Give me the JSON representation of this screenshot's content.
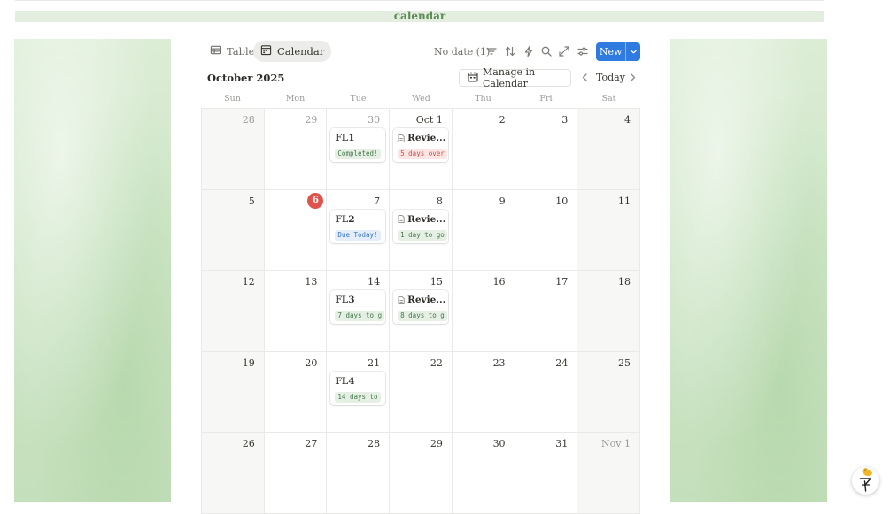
{
  "page": {
    "banner_title": "calendar",
    "colors": {
      "accent": "#2f7be0",
      "today": "#e0534c",
      "banner_bg": "#e3ede0",
      "banner_text": "#5b8a57"
    }
  },
  "views": [
    {
      "label": "Table",
      "icon": "table-icon",
      "active": false
    },
    {
      "label": "Calendar",
      "icon": "calendar-icon",
      "active": true
    }
  ],
  "toolbar": {
    "no_date": "No date (1)",
    "icons": [
      "filter-icon",
      "sort-icon",
      "automation-icon",
      "search-icon",
      "expand-icon",
      "settings-icon"
    ],
    "new_label": "New"
  },
  "calendar": {
    "month_label": "October 2025",
    "manage_label": "Manage in Calendar",
    "today_label": "Today",
    "weekdays": [
      "Sun",
      "Mon",
      "Tue",
      "Wed",
      "Thu",
      "Fri",
      "Sat"
    ],
    "weeks": [
      [
        {
          "label": "28",
          "muted": true
        },
        {
          "label": "29",
          "muted": true
        },
        {
          "label": "30",
          "muted": true,
          "event": {
            "title": "FL1",
            "badge": "Completed!",
            "badge_color": "green",
            "doc_icon": false
          }
        },
        {
          "label": "Oct 1",
          "event": {
            "title": "Revie...",
            "badge": "5 days over",
            "badge_color": "red",
            "doc_icon": true
          }
        },
        {
          "label": "2"
        },
        {
          "label": "3"
        },
        {
          "label": "4"
        }
      ],
      [
        {
          "label": "5"
        },
        {
          "label": "6",
          "today": true
        },
        {
          "label": "7",
          "event": {
            "title": "FL2",
            "badge": "Due Today!",
            "badge_color": "blue",
            "doc_icon": false
          }
        },
        {
          "label": "8",
          "event": {
            "title": "Revie...",
            "badge": "1 day to go",
            "badge_color": "green",
            "doc_icon": true
          }
        },
        {
          "label": "9"
        },
        {
          "label": "10"
        },
        {
          "label": "11"
        }
      ],
      [
        {
          "label": "12"
        },
        {
          "label": "13"
        },
        {
          "label": "14",
          "event": {
            "title": "FL3",
            "badge": "7 days to g",
            "badge_color": "green",
            "doc_icon": false
          }
        },
        {
          "label": "15",
          "event": {
            "title": "Revie...",
            "badge": "8 days to g",
            "badge_color": "green",
            "doc_icon": true
          }
        },
        {
          "label": "16"
        },
        {
          "label": "17"
        },
        {
          "label": "18"
        }
      ],
      [
        {
          "label": "19"
        },
        {
          "label": "20"
        },
        {
          "label": "21",
          "event": {
            "title": "FL4",
            "badge": "14 days to",
            "badge_color": "green",
            "doc_icon": false
          }
        },
        {
          "label": "22"
        },
        {
          "label": "23"
        },
        {
          "label": "24"
        },
        {
          "label": "25"
        }
      ],
      [
        {
          "label": "26"
        },
        {
          "label": "27"
        },
        {
          "label": "28"
        },
        {
          "label": "29"
        },
        {
          "label": "30"
        },
        {
          "label": "31"
        },
        {
          "label": "Nov 1",
          "muted": true
        }
      ]
    ]
  },
  "help_widget": {
    "icon": "duck-help-icon"
  }
}
